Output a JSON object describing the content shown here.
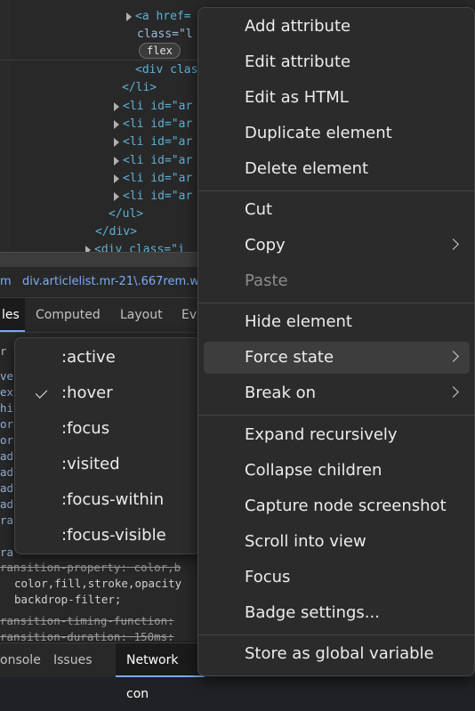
{
  "elements_tree": {
    "lines": [
      "<a href=",
      "class=\"l",
      "flex",
      "<div clas",
      "</li>",
      "<li id=\"ar",
      "<li id=\"ar",
      "<li id=\"ar",
      "<li id=\"ar",
      "<li id=\"ar",
      "<li id=\"ar",
      "</ul>",
      "</div>",
      "<div class=\"i"
    ]
  },
  "breadcrumb": {
    "prefix": "m",
    "current": "div.articlelist.mr-21\\.667rem.w"
  },
  "styles_tabs": [
    "les",
    "Computed",
    "Layout",
    "Ev"
  ],
  "styles_lines": {
    "filter_stub": "r",
    "left_stubs": [
      "ve",
      "ext",
      "hit",
      "ore",
      "ore",
      "adc",
      "adc",
      "adc",
      "adc",
      "ra",
      "",
      "ra"
    ],
    "transition_property": "ransition-property: color,b",
    "transition_values_1": "color,fill,stroke,opacity",
    "transition_values_2": "backdrop-filter;",
    "transition_timing": "ransition-timing-function:",
    "transition_duration": "ransition-duration: 150ms;"
  },
  "drawer_tabs": [
    "onsole",
    "Issues",
    "Network con"
  ],
  "context_menu": {
    "group1": [
      "Add attribute",
      "Edit attribute",
      "Edit as HTML",
      "Duplicate element",
      "Delete element"
    ],
    "group2": [
      "Cut",
      "Copy",
      "Paste"
    ],
    "group3": [
      "Hide element",
      "Force state",
      "Break on"
    ],
    "group4": [
      "Expand recursively",
      "Collapse children",
      "Capture node screenshot",
      "Scroll into view",
      "Focus",
      "Badge settings..."
    ],
    "group5": [
      "Store as global variable"
    ]
  },
  "force_state_menu": {
    "items": [
      ":active",
      ":hover",
      ":focus",
      ":visited",
      ":focus-within",
      ":focus-visible"
    ],
    "checked": ":hover"
  }
}
